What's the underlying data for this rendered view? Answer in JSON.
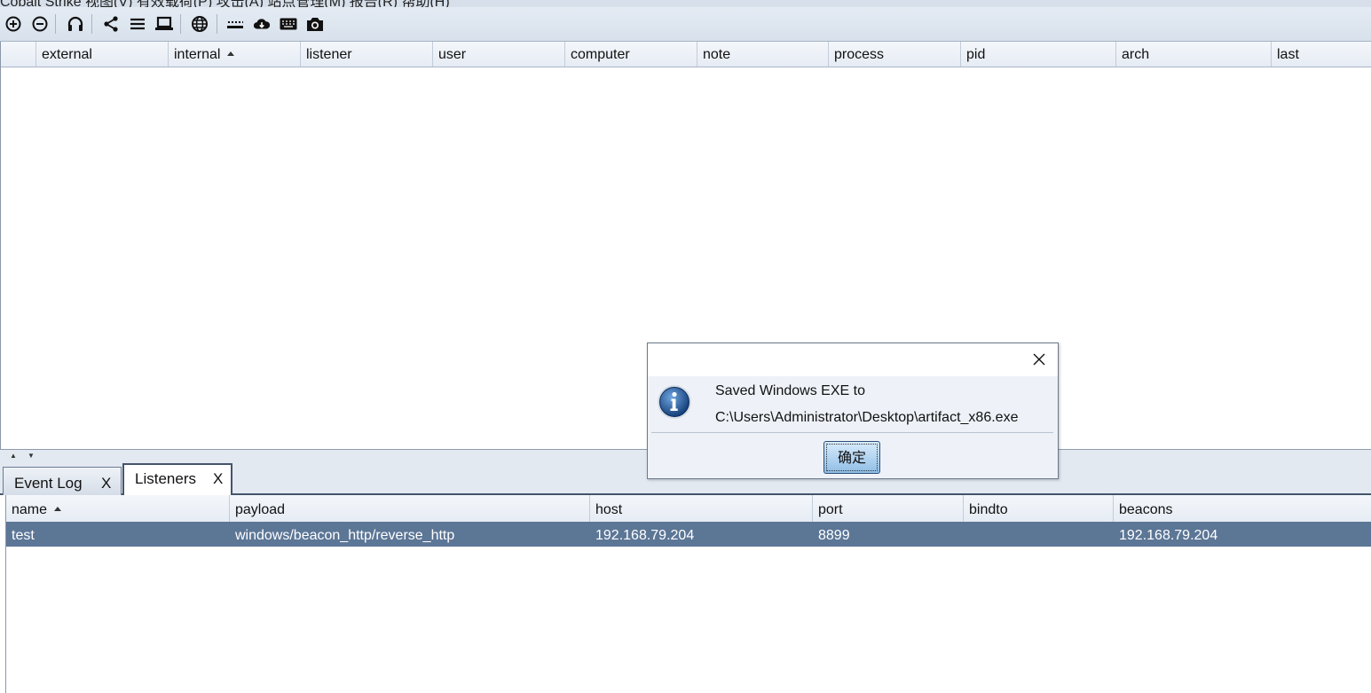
{
  "menubar": {
    "text": "Cobalt Strike  视图(V)  有效载荷(P)  攻击(A)  站点管理(M)  报告(R)  帮助(H)"
  },
  "toolbar": {
    "icons": [
      "plus-circle-icon",
      "minus-circle-icon",
      "headphones-icon",
      "share-icon",
      "list-icon",
      "laptop-icon",
      "globe-icon",
      "keys-icon",
      "cloud-download-icon",
      "keyboard-icon",
      "camera-icon"
    ]
  },
  "sessions_table": {
    "columns": [
      "external",
      "internal",
      "listener",
      "user",
      "computer",
      "note",
      "process",
      "pid",
      "arch",
      "last"
    ],
    "sorted_column": "internal"
  },
  "tabs": [
    {
      "label": "Event Log",
      "close": "X"
    },
    {
      "label": "Listeners",
      "close": "X"
    }
  ],
  "listeners_table": {
    "columns": [
      "name",
      "payload",
      "host",
      "port",
      "bindto",
      "beacons"
    ],
    "sorted_column": "name",
    "rows": [
      {
        "name": "test",
        "payload": "windows/beacon_http/reverse_http",
        "host": "192.168.79.204",
        "port": "8899",
        "bindto": "",
        "beacons": "192.168.79.204"
      }
    ]
  },
  "dialog": {
    "line1": "Saved Windows EXE to",
    "line2": "C:\\Users\\Administrator\\Desktop\\artifact_x86.exe",
    "ok_label": "确定"
  },
  "colors": {
    "selection": "#5c7696",
    "toolbar": "#dde5ef"
  }
}
